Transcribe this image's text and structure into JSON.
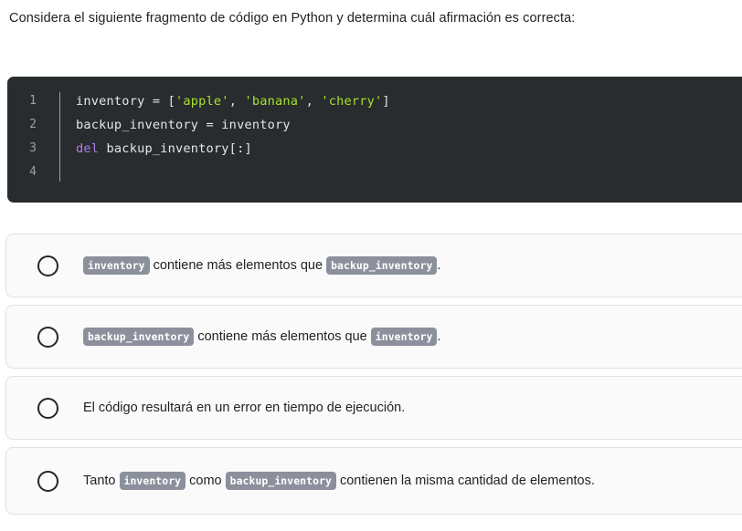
{
  "prompt": "Considera el siguiente fragmento de código en Python y determina cuál afirmación es correcta:",
  "code": {
    "language": "python",
    "line_numbers": [
      "1",
      "2",
      "3",
      "4"
    ],
    "lines": [
      {
        "id": 1,
        "segments": [
          {
            "text": "inventory = [",
            "type": "plain"
          },
          {
            "text": "'apple'",
            "type": "string"
          },
          {
            "text": ", ",
            "type": "plain"
          },
          {
            "text": "'banana'",
            "type": "string"
          },
          {
            "text": ", ",
            "type": "plain"
          },
          {
            "text": "'cherry'",
            "type": "string"
          },
          {
            "text": "]",
            "type": "plain"
          }
        ]
      },
      {
        "id": 2,
        "segments": [
          {
            "text": "backup_inventory = inventory",
            "type": "plain"
          }
        ]
      },
      {
        "id": 3,
        "segments": [
          {
            "text": "del",
            "type": "keyword"
          },
          {
            "text": " backup_inventory[:]",
            "type": "plain"
          }
        ]
      },
      {
        "id": 4,
        "segments": [
          {
            "text": "",
            "type": "plain"
          }
        ]
      }
    ],
    "colors": {
      "background": "#282c2e",
      "text": "#e6e6e6",
      "string": "#a6e22e",
      "keyword": "#b07dea",
      "line_number": "#9aa0a3",
      "gutter_rule": "#9ba1a4"
    }
  },
  "options": [
    {
      "id": "option-1",
      "selected": false,
      "parts": [
        {
          "text": "inventory",
          "type": "code"
        },
        {
          "text": " contiene más elementos que ",
          "type": "text"
        },
        {
          "text": "backup_inventory",
          "type": "code"
        },
        {
          "text": ".",
          "type": "text"
        }
      ]
    },
    {
      "id": "option-2",
      "selected": false,
      "parts": [
        {
          "text": "backup_inventory",
          "type": "code"
        },
        {
          "text": " contiene más elementos que ",
          "type": "text"
        },
        {
          "text": "inventory",
          "type": "code"
        },
        {
          "text": ".",
          "type": "text"
        }
      ]
    },
    {
      "id": "option-3",
      "selected": false,
      "parts": [
        {
          "text": "El código resultará en un error en tiempo de ejecución.",
          "type": "text"
        }
      ]
    },
    {
      "id": "option-4",
      "selected": false,
      "parts": [
        {
          "text": "Tanto ",
          "type": "text"
        },
        {
          "text": "inventory",
          "type": "code"
        },
        {
          "text": " como ",
          "type": "text"
        },
        {
          "text": "backup_inventory",
          "type": "code"
        },
        {
          "text": " contienen la misma cantidad de elementos.",
          "type": "text"
        }
      ]
    }
  ],
  "colors": {
    "page_background": "#ffffff",
    "option_background": "#fafafb",
    "option_border": "#dde2ea",
    "radio_border": "#24262b",
    "chip_background": "#8b909c",
    "chip_text": "#ffffff",
    "body_text": "#1f2023"
  }
}
